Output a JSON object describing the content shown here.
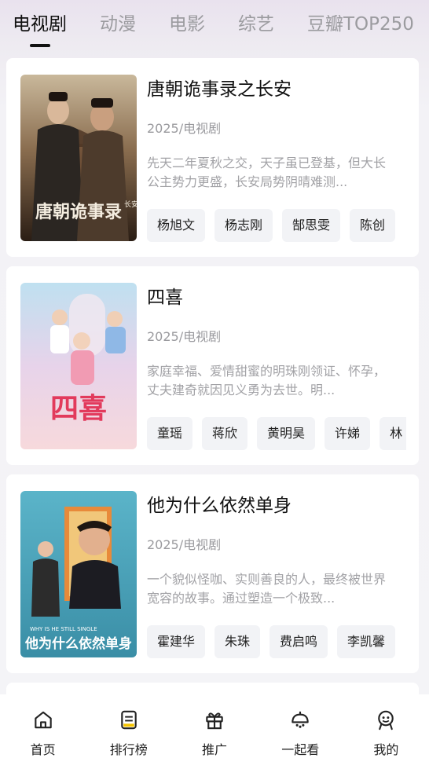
{
  "tabs": [
    {
      "label": "电视剧",
      "active": true
    },
    {
      "label": "动漫",
      "active": false
    },
    {
      "label": "电影",
      "active": false
    },
    {
      "label": "综艺",
      "active": false
    },
    {
      "label": "豆瓣TOP250",
      "active": false
    }
  ],
  "cards": [
    {
      "title": "唐朝诡事录之长安",
      "meta": "2025/电视剧",
      "description": "先天二年夏秋之交，天子虽已登基，但大长公主势力更盛，长安局势阴晴难测...",
      "cast": [
        "杨旭文",
        "杨志刚",
        "郜思雯",
        "陈创"
      ],
      "poster_text": "唐朝诡事录",
      "poster_subtext": "长安"
    },
    {
      "title": "四喜",
      "meta": "2025/电视剧",
      "description": "家庭幸福、爱情甜蜜的明珠刚领证、怀孕，丈夫建奇就因见义勇为去世。明...",
      "cast": [
        "童瑶",
        "蒋欣",
        "黄明昊",
        "许娣",
        "林"
      ],
      "poster_text": "四喜"
    },
    {
      "title": "他为什么依然单身",
      "meta": "2025/电视剧",
      "description": "一个貌似怪咖、实则善良的人，最终被世界宽容的故事。通过塑造一个极致...",
      "cast": [
        "霍建华",
        "朱珠",
        "费启鸣",
        "李凯馨"
      ],
      "poster_text": "他为什么依然单身",
      "poster_subtext": "WHY IS HE STILL SINGLE"
    }
  ],
  "bottom_nav": [
    {
      "label": "首页",
      "icon": "home-icon"
    },
    {
      "label": "排行榜",
      "icon": "ranking-icon"
    },
    {
      "label": "推广",
      "icon": "gift-icon"
    },
    {
      "label": "一起看",
      "icon": "watch-together-icon"
    },
    {
      "label": "我的",
      "icon": "profile-icon"
    }
  ],
  "colors": {
    "accent_text": "#111111",
    "muted_text": "#9a9a9e",
    "tag_bg": "#f2f3f6"
  }
}
